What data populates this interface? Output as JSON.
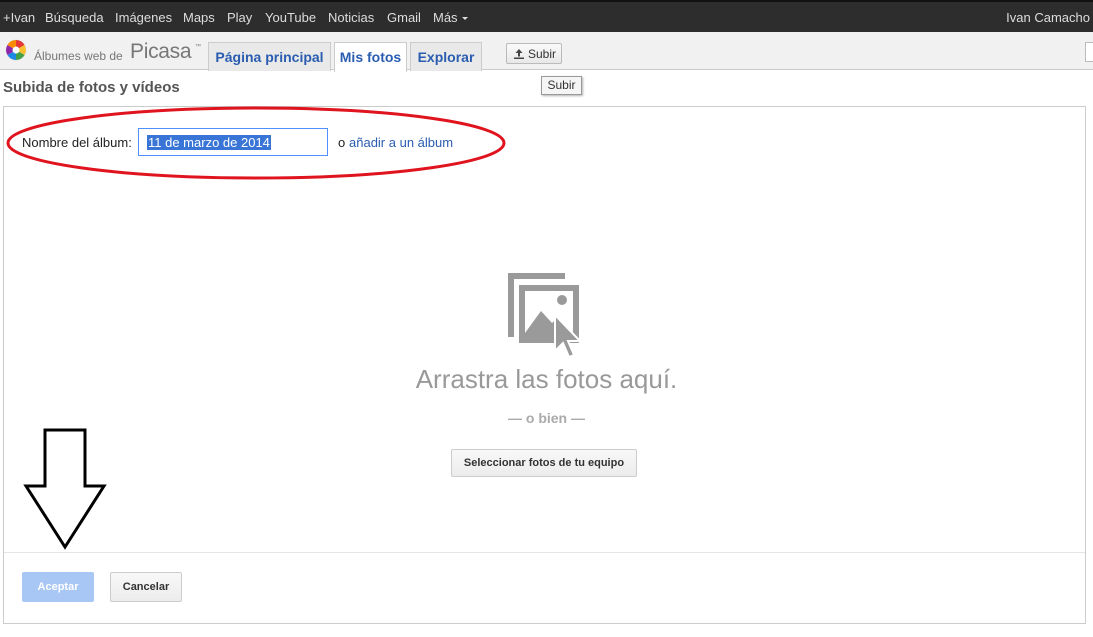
{
  "gbar": {
    "links": [
      "+Ivan",
      "Búsqueda",
      "Imágenes",
      "Maps",
      "Play",
      "YouTube",
      "Noticias",
      "Gmail",
      "Más"
    ],
    "user": "Ivan Camacho"
  },
  "header": {
    "brand_prefix": "Álbumes web de",
    "brand_name": "Picasa",
    "brand_tm": "™",
    "tabs": [
      "Página principal",
      "Mis fotos",
      "Explorar"
    ],
    "active_tab": "Mis fotos",
    "upload_label": "Subir",
    "upload_icon": "upload-icon"
  },
  "tooltip": "Subir",
  "page": {
    "title": "Subida de fotos y vídeos"
  },
  "album": {
    "label": "Nombre del álbum:",
    "value": "11 de marzo de 2014",
    "or": "o",
    "add_link": "añadir a un álbum"
  },
  "dropzone": {
    "icon": "photo-drop-icon",
    "text": "Arrastra las fotos aquí.",
    "or_text": "— o bien —",
    "select_label": "Seleccionar fotos de tu equipo"
  },
  "actions": {
    "accept": "Aceptar",
    "cancel": "Cancelar"
  },
  "colors": {
    "gbar_bg": "#2d2d2d",
    "link_blue": "#2a5db0",
    "annotation_red": "#e0141e",
    "accept_disabled": "#a9c7f5"
  }
}
